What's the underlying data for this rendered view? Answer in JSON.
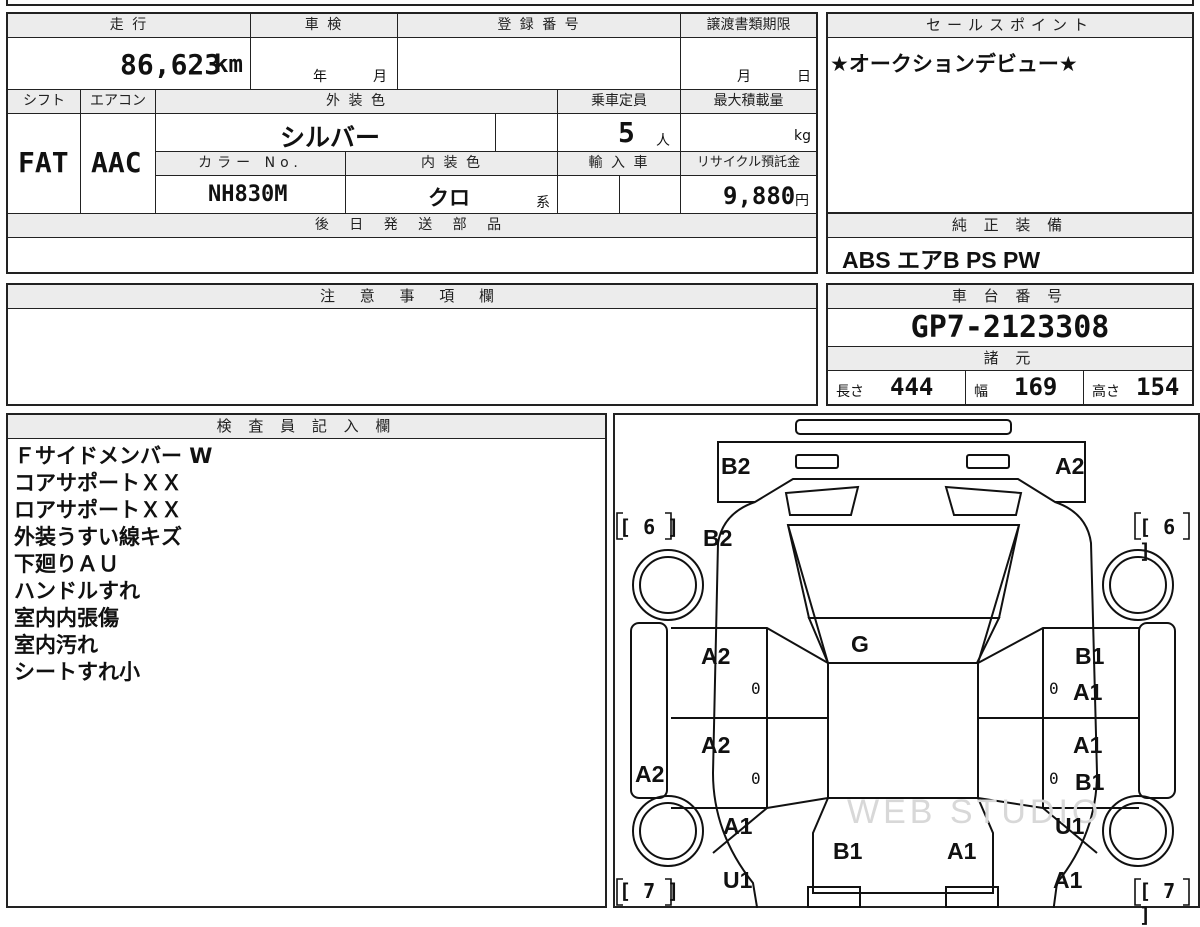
{
  "top": {
    "mileage_label": "走 行",
    "mileage_value": "86,623",
    "mileage_unit": "km",
    "shaken_label": "車 検",
    "shaken_year": "年",
    "shaken_month": "月",
    "reg_label": "登 録 番 号",
    "reg_value": "",
    "transfer_label": "譲渡書類期限",
    "transfer_month": "月",
    "transfer_day": "日",
    "shift_label": "シフト",
    "shift_value": "FAT",
    "ac_label": "エアコン",
    "ac_value": "AAC",
    "exterior_label": "外 装 色",
    "exterior_value": "シルバー",
    "capacity_label": "乗車定員",
    "capacity_value": "5",
    "capacity_unit": "人",
    "maxload_label": "最大積載量",
    "maxload_unit": "kg",
    "color_no_label": "カラー No.",
    "color_no_value": "NH830M",
    "interior_label": "内 装 色",
    "interior_value": "クロ",
    "interior_suffix": "系",
    "import_label": "輸 入 車",
    "recycle_label": "リサイクル預託金",
    "recycle_value": "9,880",
    "recycle_unit": "円",
    "later_parts_label": "後 日 発 送 部 品",
    "later_parts_value": ""
  },
  "sales": {
    "label": "セールスポイント",
    "text": "★オークションデビュー★"
  },
  "equipment": {
    "label": "純 正 装 備",
    "text": "ABS エアB PS PW"
  },
  "notes": {
    "label": "注 意 事 項 欄",
    "text": ""
  },
  "chassis": {
    "label": "車 台 番 号",
    "value": "GP7-2123308",
    "specs_label": "諸 元",
    "length_label": "長さ",
    "length_value": "444",
    "width_label": "幅",
    "width_value": "169",
    "height_label": "高さ",
    "height_value": "154"
  },
  "inspector": {
    "label": "検 査 員 記 入 欄",
    "lines": [
      "Ｆサイドメンバー W",
      "コアサポートＸＸ",
      "ロアサポートＸＸ",
      "外装うすい線キズ",
      "下廻りＡＵ",
      "ハンドルすれ",
      "室内内張傷",
      "室内汚れ",
      "シートすれ小"
    ]
  },
  "diagram": {
    "tread_fl": "[ 6 ]",
    "tread_fr": "[ 6 ]",
    "tread_rl": "[ 7 ]",
    "tread_rr": "[ 7 ]",
    "marks": {
      "front_bumper_left": "B2",
      "front_bumper_right": "A2",
      "fender_front_left": "B2",
      "windshield": "G",
      "door_front_left": "A2",
      "door_front_right_1": "B1",
      "door_front_right_2": "A1",
      "door_rear_left": "A2",
      "door_rear_right_1": "A1",
      "door_rear_right_2": "B1",
      "sill_left": "A2",
      "quarter_left": "A1",
      "quarter_right": "U1",
      "rear_gate_left": "B1",
      "rear_gate_right": "A1",
      "rear_bumper_left": "U1",
      "rear_bumper_right": "A1"
    },
    "zero_marks": [
      "0",
      "0",
      "0",
      "0"
    ],
    "watermark": "WEB STUDIO"
  },
  "colors": {
    "border": "#222222",
    "label_bg": "#ececec"
  }
}
